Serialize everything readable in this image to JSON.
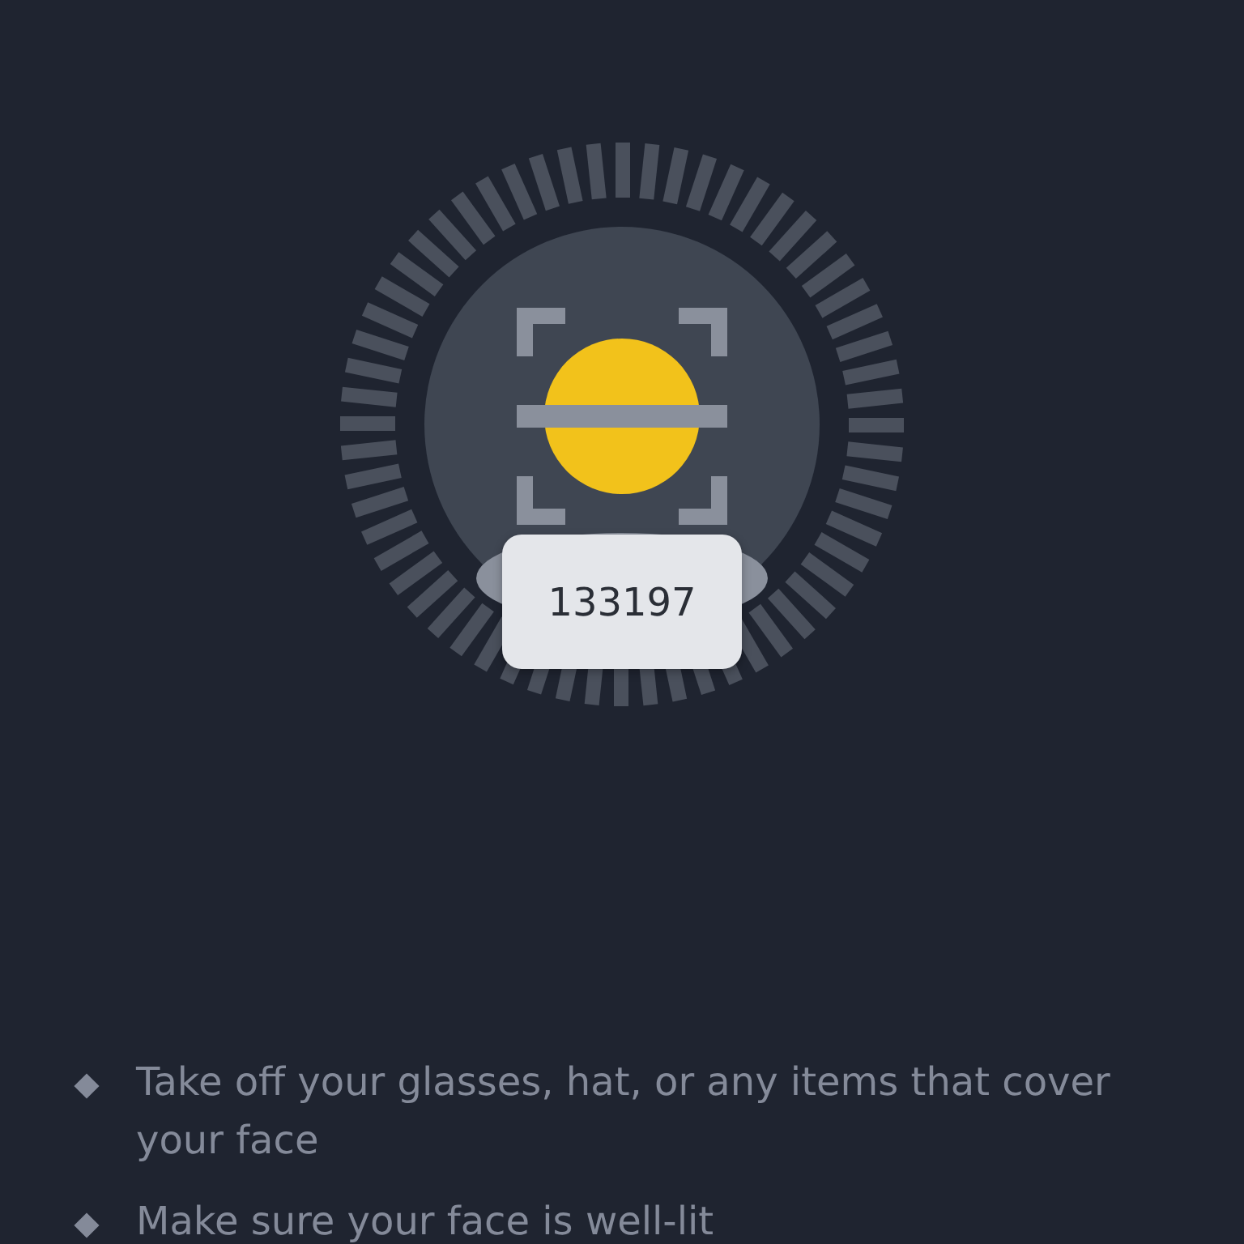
{
  "verification_code": "133197",
  "tips": [
    "Take off your glasses, hat, or any items that cover your face",
    "Make sure your face is well-lit"
  ]
}
